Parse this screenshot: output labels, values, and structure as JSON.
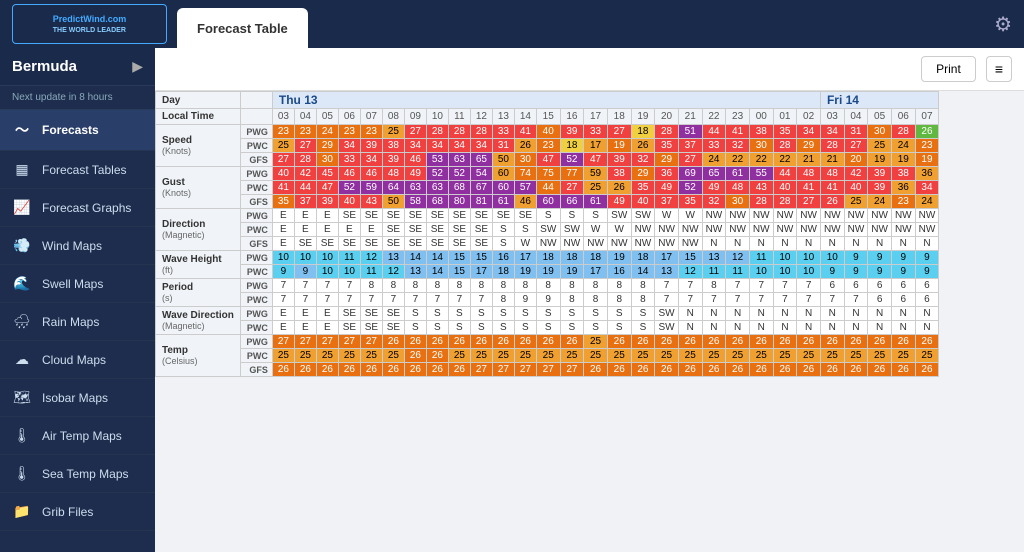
{
  "header": {
    "logo_text": "PredictWind.com",
    "tab_label": "Forecast Table",
    "gear_label": "⚙"
  },
  "sidebar": {
    "location": "Bermuda",
    "update_text": "Next update in 8 hours",
    "nav_items": [
      {
        "label": "Forecasts",
        "icon": "🌊",
        "active": true
      },
      {
        "label": "Forecast Tables",
        "icon": "📋",
        "active": false
      },
      {
        "label": "Forecast Graphs",
        "icon": "📈",
        "active": false
      },
      {
        "label": "Wind Maps",
        "icon": "💨",
        "active": false
      },
      {
        "label": "Swell Maps",
        "icon": "🌊",
        "active": false
      },
      {
        "label": "Rain Maps",
        "icon": "🌧",
        "active": false
      },
      {
        "label": "Cloud Maps",
        "icon": "☁",
        "active": false
      },
      {
        "label": "Isobar Maps",
        "icon": "🗺",
        "active": false
      },
      {
        "label": "Air Temp Maps",
        "icon": "🌡",
        "active": false
      },
      {
        "label": "Sea Temp Maps",
        "icon": "🌡",
        "active": false
      },
      {
        "label": "Grib Files",
        "icon": "📁",
        "active": false
      }
    ]
  },
  "toolbar": {
    "print_label": "Print"
  }
}
